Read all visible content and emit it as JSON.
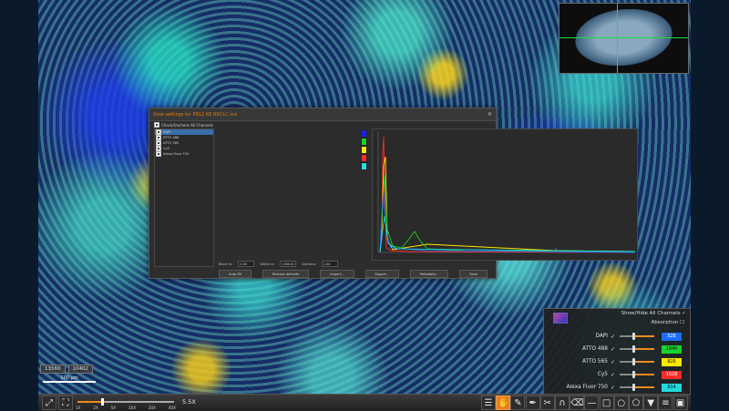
{
  "dialog": {
    "title": "View settings for PDL1 K8 NSCLC.svs",
    "close_label": "✕",
    "check_all_label": "Check/Uncheck All Channels",
    "channels": [
      {
        "label": "DAPI",
        "checked": true,
        "color": "#1c1cff"
      },
      {
        "label": "ATTO 488",
        "checked": true,
        "color": "#16d21a"
      },
      {
        "label": "ATTO 565",
        "checked": true,
        "color": "#ffe600"
      },
      {
        "label": "Cy5",
        "checked": true,
        "color": "#ff2a2a"
      },
      {
        "label": "Alexa Fluor 750",
        "checked": true,
        "color": "#21e0e0"
      }
    ],
    "black_label": "Black in:",
    "black_value": "0.00",
    "white_label": "White in:",
    "white_value": "1000.00",
    "gamma_label": "Gamma:",
    "gamma_value": "1.00",
    "hist_axis_label": "0",
    "buttons": {
      "auto": "Auto-Fit",
      "defaults": "Restore defaults",
      "import": "Import...",
      "export": "Export...",
      "metadata": "Metadata...",
      "save": "Save"
    }
  },
  "channels_panel": {
    "show_all_label": "Show/Hide All Channels ✓",
    "absorption_label": "Absorption ☐",
    "rows": [
      {
        "name": "DAPI",
        "value": "528",
        "color": "#1c6dff",
        "text_color": "#ffffff"
      },
      {
        "name": "ATTO 488",
        "value": "1040",
        "color": "#18d22b",
        "text_color": "#111111"
      },
      {
        "name": "ATTO 565",
        "value": "826",
        "color": "#ffe800",
        "text_color": "#111111"
      },
      {
        "name": "Cy5",
        "value": "1528",
        "color": "#ff2a2a",
        "text_color": "#ffffff"
      },
      {
        "name": "Alexa Fluor 750",
        "value": "814",
        "color": "#20d8dc",
        "text_color": "#111111"
      }
    ]
  },
  "coords": {
    "x": "13560",
    "y": "10402"
  },
  "scale_bar": {
    "label": "100 µm"
  },
  "toolbar": {
    "zoom_level": "5.5X",
    "zoom_fraction": 0.26,
    "zoom_ticks": [
      "1X",
      "2X",
      "5X",
      "10X",
      "20X",
      "40X"
    ],
    "buttons": [
      {
        "name": "fullscreen-icon",
        "glyph": "⤢"
      },
      {
        "name": "fit-icon",
        "glyph": "⛶"
      },
      {
        "name": "layers-icon",
        "glyph": "☰"
      },
      {
        "name": "hand-icon",
        "glyph": "✋"
      },
      {
        "name": "brush-icon",
        "glyph": "✎"
      },
      {
        "name": "pen-icon",
        "glyph": "✒"
      },
      {
        "name": "scissors-icon",
        "glyph": "✂"
      },
      {
        "name": "magnet-icon",
        "glyph": "∩"
      },
      {
        "name": "eraser-icon",
        "glyph": "⌫"
      },
      {
        "name": "ruler-icon",
        "glyph": "—"
      },
      {
        "name": "rectangle-icon",
        "glyph": "□"
      },
      {
        "name": "ellipse-icon",
        "glyph": "○"
      },
      {
        "name": "polygon-icon",
        "glyph": "⬠"
      },
      {
        "name": "pin-icon",
        "glyph": "▼"
      },
      {
        "name": "list-icon",
        "glyph": "≡"
      },
      {
        "name": "camera-icon",
        "glyph": "▣"
      }
    ],
    "active_tool": "hand-icon"
  }
}
